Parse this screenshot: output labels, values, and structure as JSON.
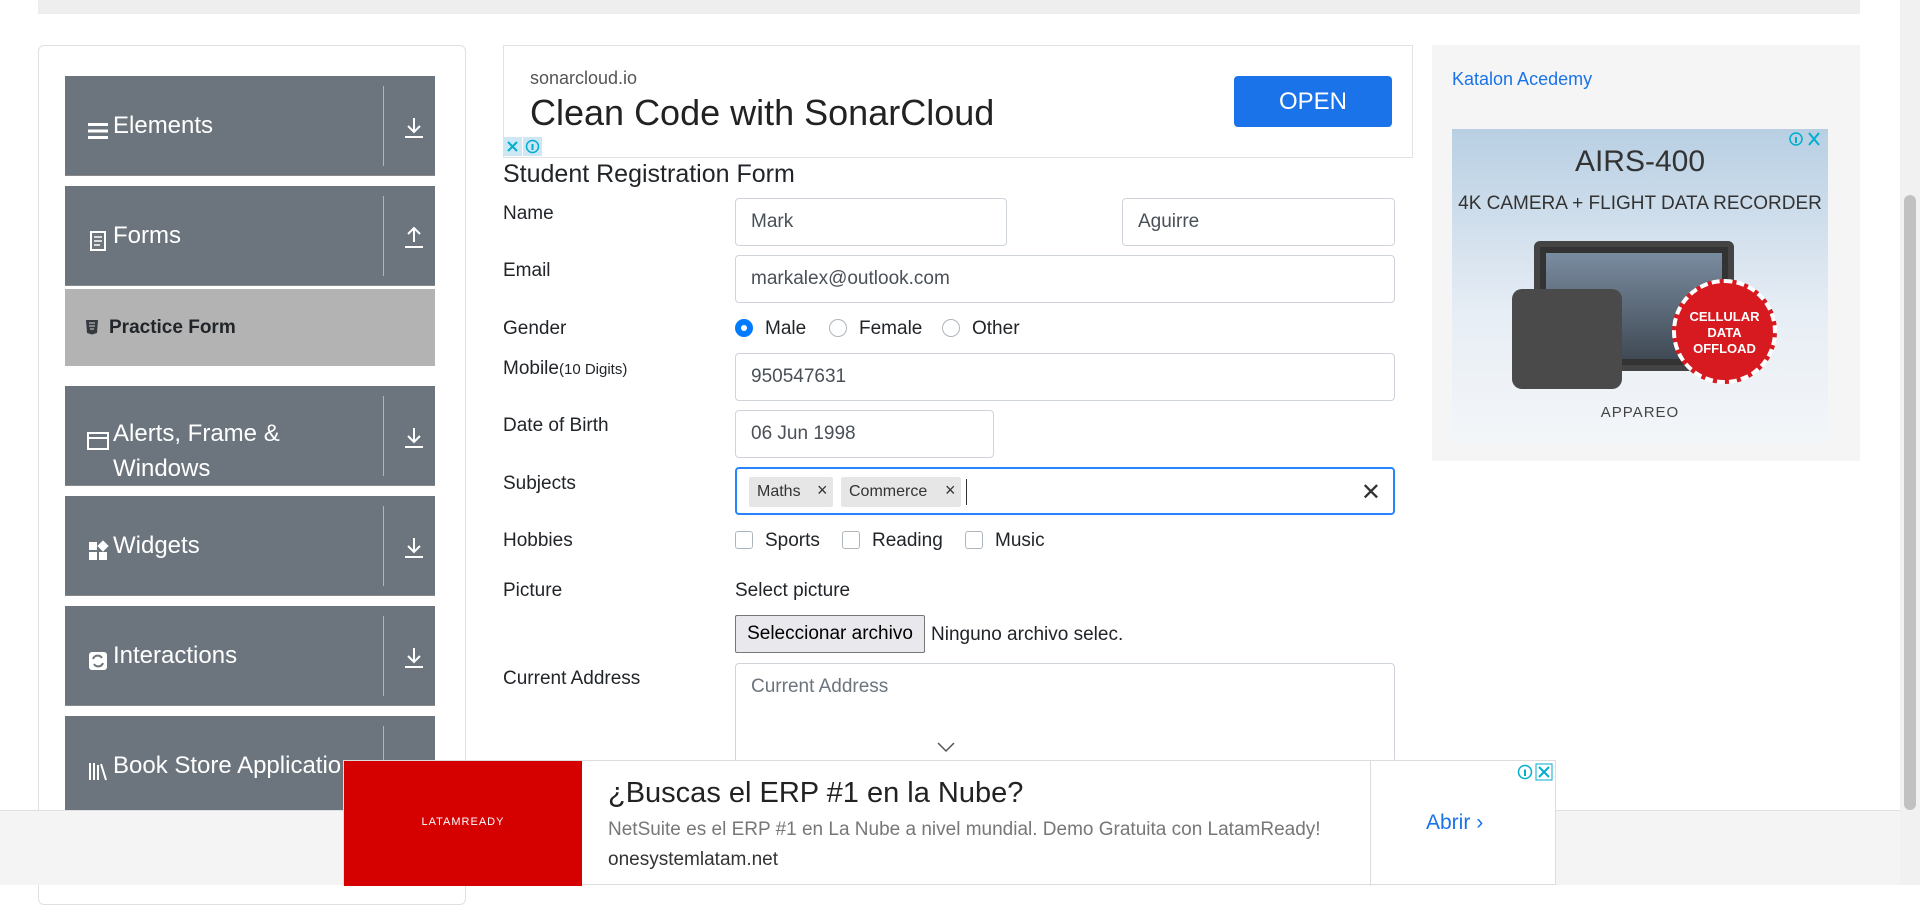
{
  "sidebar": {
    "groups": [
      {
        "label": "Elements",
        "icon": "hamburger-icon",
        "arrow": "download-arrow-icon"
      },
      {
        "label": "Forms",
        "icon": "document-icon",
        "arrow": "upload-arrow-icon"
      },
      {
        "label": "Alerts, Frame & Windows",
        "icon": "window-icon",
        "arrow": "download-arrow-icon"
      },
      {
        "label": "Widgets",
        "icon": "widgets-icon",
        "arrow": "download-arrow-icon"
      },
      {
        "label": "Interactions",
        "icon": "interactions-icon",
        "arrow": "download-arrow-icon"
      },
      {
        "label": "Book Store Applicatio",
        "icon": "books-icon",
        "arrow": "download-arrow-icon"
      }
    ],
    "active_item": "Practice Form"
  },
  "top_ad": {
    "domain": "sonarcloud.io",
    "headline": "Clean Code with SonarCloud",
    "cta": "OPEN"
  },
  "form": {
    "title": "Student Registration Form",
    "labels": {
      "name": "Name",
      "email": "Email",
      "gender": "Gender",
      "mobile": "Mobile",
      "mobile_hint": "(10 Digits)",
      "dob": "Date of Birth",
      "subjects": "Subjects",
      "hobbies": "Hobbies",
      "picture": "Picture",
      "address": "Current Address"
    },
    "first_name": "Mark",
    "last_name": "Aguirre",
    "email": "markalex@outlook.com",
    "gender_options": [
      "Male",
      "Female",
      "Other"
    ],
    "gender_selected": "Male",
    "mobile": "950547631",
    "dob": "06 Jun 1998",
    "subjects": [
      "Maths",
      "Commerce"
    ],
    "chip_remove": "×",
    "clear_subjects": "✕",
    "hobbies": [
      "Sports",
      "Reading",
      "Music"
    ],
    "picture_label": "Select picture",
    "file_button": "Seleccionar archivo",
    "file_status": "Ninguno archivo selec.",
    "address_placeholder": "Current Address"
  },
  "right_ad": {
    "link_text": "Katalon Acedemy",
    "title": "AIRS-400",
    "subtitle": "4K CAMERA + FLIGHT DATA RECORDER",
    "seal_text": "CELLULAR DATA OFFLOAD",
    "brand": "APPAREO"
  },
  "bottom_ad": {
    "logo": "LATAMREADY",
    "headline": "¿Buscas el ERP #1 en la Nube?",
    "description": "NetSuite es el ERP #1 en La Nube a nivel mundial. Demo Gratuita con LatamReady!",
    "domain": "onesystemlatam.net",
    "cta": "Abrir"
  },
  "colors": {
    "sidebar_group": "#6c757d",
    "sidebar_active": "#b3b3b3",
    "primary": "#007bff",
    "focus_border": "#2684ff",
    "ad_button": "#1a73e8",
    "bottom_ad_red": "#d50000"
  }
}
